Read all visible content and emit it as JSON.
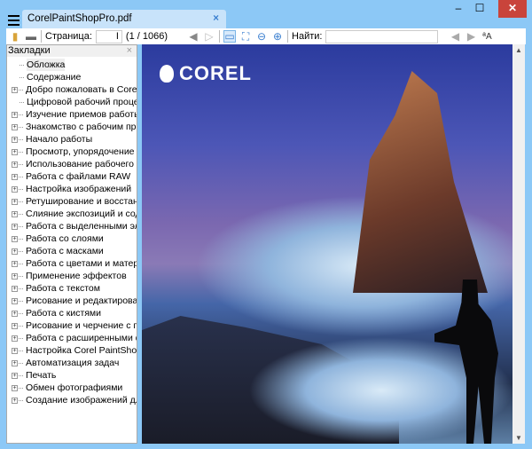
{
  "window": {
    "tab_title": "CorelPaintShopPro.pdf",
    "minimize": "–",
    "maximize": "☐",
    "close": "✕",
    "tab_close": "×"
  },
  "toolbar": {
    "page_label": "Страница:",
    "page_value": "I",
    "page_count": "(1 / 1066)",
    "find_label": "Найти:",
    "find_value": ""
  },
  "sidebar": {
    "title": "Закладки",
    "close": "×",
    "items": [
      {
        "label": "Обложка",
        "expandable": false,
        "selected": true
      },
      {
        "label": "Содержание",
        "expandable": false
      },
      {
        "label": "Добро пожаловать в Corel PaintShop Pro",
        "expandable": true
      },
      {
        "label": "Цифровой рабочий процесс",
        "expandable": false
      },
      {
        "label": "Изучение приемов работы в Corel PaintShop Pro",
        "expandable": true
      },
      {
        "label": "Знакомство с рабочим пространством",
        "expandable": true
      },
      {
        "label": "Начало работы",
        "expandable": true
      },
      {
        "label": "Просмотр, упорядочение и поиск фотографий",
        "expandable": true
      },
      {
        "label": "Использование рабочего пространства",
        "expandable": true
      },
      {
        "label": "Работа с файлами RAW",
        "expandable": true
      },
      {
        "label": "Настройка изображений",
        "expandable": true
      },
      {
        "label": "Ретуширование и восстановление изображений",
        "expandable": true
      },
      {
        "label": "Слияние экспозиций и содержимого",
        "expandable": true
      },
      {
        "label": "Работа с выделенными элементами",
        "expandable": true
      },
      {
        "label": "Работа со слоями",
        "expandable": true
      },
      {
        "label": "Работа с масками",
        "expandable": true
      },
      {
        "label": "Работа с цветами и материалами",
        "expandable": true
      },
      {
        "label": "Применение эффектов",
        "expandable": true
      },
      {
        "label": "Работа с текстом",
        "expandable": true
      },
      {
        "label": "Рисование и редактирование",
        "expandable": true
      },
      {
        "label": "Работа с кистями",
        "expandable": true
      },
      {
        "label": "Рисование и черчение с помощью",
        "expandable": true
      },
      {
        "label": "Работа с расширенными функциями",
        "expandable": true
      },
      {
        "label": "Настройка Corel PaintShop Pro",
        "expandable": true
      },
      {
        "label": "Автоматизация задач",
        "expandable": true
      },
      {
        "label": "Печать",
        "expandable": true
      },
      {
        "label": "Обмен фотографиями",
        "expandable": true
      },
      {
        "label": "Создание изображений для Интернета",
        "expandable": true
      }
    ]
  },
  "document": {
    "logo_text": "COREL"
  }
}
